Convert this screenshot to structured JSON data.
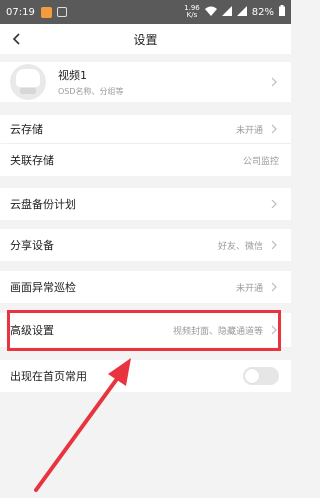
{
  "status_bar": {
    "time": "07:19",
    "net_speed_top": "1.96",
    "net_speed_bottom": "K/s",
    "battery": "82%"
  },
  "header": {
    "title": "设置"
  },
  "device": {
    "name": "视频1",
    "subtitle": "OSD名称、分组等"
  },
  "rows": {
    "cloud_storage": {
      "label": "云存储",
      "value": "未开通"
    },
    "linked_storage": {
      "label": "关联存储",
      "value": "公司监控"
    },
    "cloud_backup": {
      "label": "云盘备份计划"
    },
    "share_device": {
      "label": "分享设备",
      "value": "好友、微信"
    },
    "anomaly_patrol": {
      "label": "画面异常巡检",
      "value": "未开通"
    },
    "advanced": {
      "label": "高级设置",
      "value": "视频封面、隐藏通道等"
    },
    "home_common": {
      "label": "出现在首页常用",
      "toggle_on": false
    }
  },
  "colors": {
    "highlight": "#e8343f",
    "background": "#f3f3f3"
  }
}
